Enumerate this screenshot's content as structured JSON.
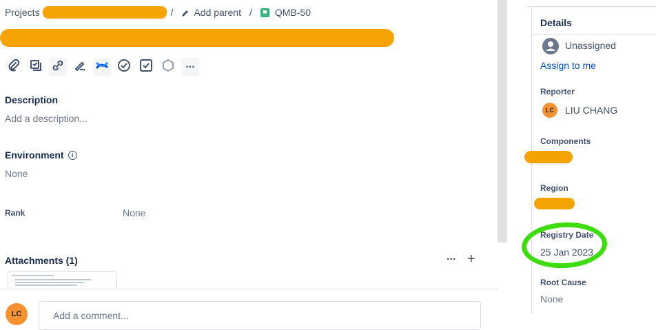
{
  "breadcrumb": {
    "projects": "Projects",
    "sep": "/",
    "add_parent": "Add parent",
    "issue_key": "QMB-50"
  },
  "toolbar": {
    "more_label": "..."
  },
  "description": {
    "label": "Description",
    "placeholder": "Add a description..."
  },
  "environment": {
    "label": "Environment",
    "value": "None",
    "info_glyph": "i"
  },
  "rank": {
    "label": "Rank",
    "value": "None"
  },
  "attachments": {
    "label": "Attachments (1)",
    "more": "...",
    "add": "+"
  },
  "comment": {
    "avatar": "LC",
    "placeholder": "Add a comment..."
  },
  "details": {
    "title": "Details",
    "assignee": "Unassigned",
    "assign_to_me": "Assign to me",
    "reporter_label": "Reporter",
    "reporter_initials": "LC",
    "reporter_name": "LIU CHANG",
    "components_label": "Components",
    "region_label": "Region",
    "registry_date_label": "Registry Date",
    "registry_date_value": "25 Jan 2023",
    "root_cause_label": "Root Cause",
    "root_cause_value": "None"
  },
  "colors": {
    "redaction": "#f4a300",
    "highlight": "#3ddc0d",
    "link": "#0052cc",
    "avatar": "#f79233"
  }
}
